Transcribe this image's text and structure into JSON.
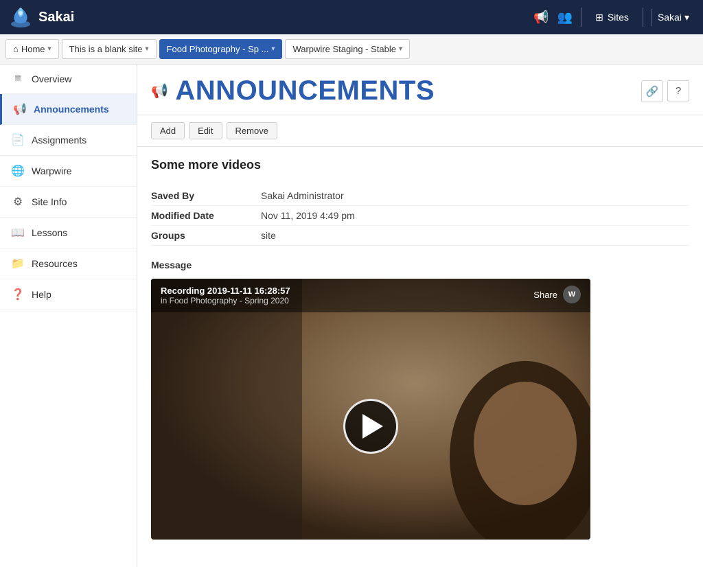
{
  "topnav": {
    "logo_text": "Sakai",
    "megaphone_icon": "📢",
    "people_icon": "👥",
    "sites_label": "Sites",
    "user_label": "Sakai",
    "user_dropdown": "▾"
  },
  "breadcrumbs": [
    {
      "id": "home",
      "label": "Home",
      "icon": "⌂",
      "active": false
    },
    {
      "id": "blank-site",
      "label": "This is a blank site",
      "active": false
    },
    {
      "id": "food-photo",
      "label": "Food Photography - Sp ...",
      "active": true
    },
    {
      "id": "warpwire",
      "label": "Warpwire Staging - Stable",
      "active": false
    }
  ],
  "sidebar": {
    "items": [
      {
        "id": "overview",
        "label": "Overview",
        "icon": "≡"
      },
      {
        "id": "announcements",
        "label": "Announcements",
        "icon": "📢",
        "active": true
      },
      {
        "id": "assignments",
        "label": "Assignments",
        "icon": "📄"
      },
      {
        "id": "warpwire",
        "label": "Warpwire",
        "icon": "🌐"
      },
      {
        "id": "site-info",
        "label": "Site Info",
        "icon": "⚙"
      },
      {
        "id": "lessons",
        "label": "Lessons",
        "icon": "📖"
      },
      {
        "id": "resources",
        "label": "Resources",
        "icon": "📁"
      },
      {
        "id": "help",
        "label": "Help",
        "icon": "❓"
      }
    ]
  },
  "announcements_page": {
    "title": "ANNOUNCEMENTS",
    "link_btn": "🔗",
    "help_btn": "?",
    "actions": [
      "Add",
      "Edit",
      "Remove"
    ],
    "announcement": {
      "title": "Some more videos",
      "saved_by_label": "Saved By",
      "saved_by_value": "Sakai Administrator",
      "modified_date_label": "Modified Date",
      "modified_date_value": "Nov 11, 2019 4:49 pm",
      "groups_label": "Groups",
      "groups_value": "site",
      "message_label": "Message"
    },
    "video": {
      "recording_title": "Recording 2019-11-11 16:28:57",
      "recording_sub": "in Food Photography - Spring 2020",
      "share_label": "Share",
      "warpwire_badge": "W"
    }
  }
}
